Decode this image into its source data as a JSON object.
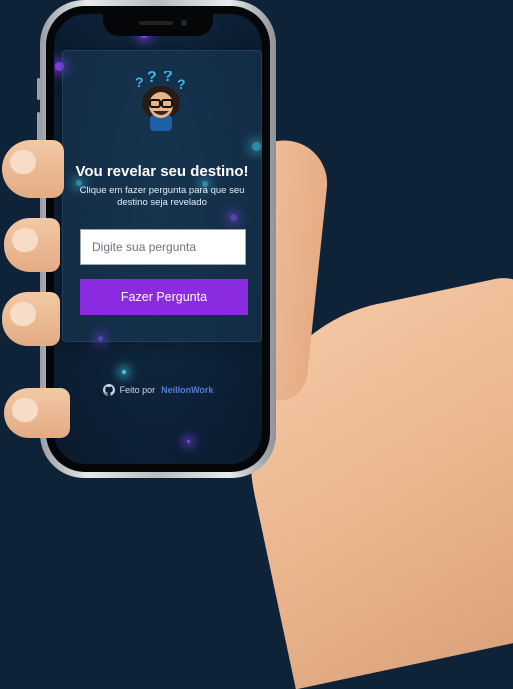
{
  "heading": "Vou revelar seu destino!",
  "subtitle": "Clique em fazer pergunta para que seu destino seja revelado",
  "question_input": {
    "placeholder": "Digite sua pergunta",
    "value": ""
  },
  "ask_button": {
    "label": "Fazer Pergunta"
  },
  "footer": {
    "made_by": "Feito por",
    "author": "NeillonWork"
  },
  "icons": {
    "avatar": "avatar-with-question-marks",
    "github": "github-icon"
  },
  "colors": {
    "background": "#0e2338",
    "button": "#8a2be2",
    "accent_link": "#4f7fd6",
    "question_marks": "#3fb6e8"
  }
}
